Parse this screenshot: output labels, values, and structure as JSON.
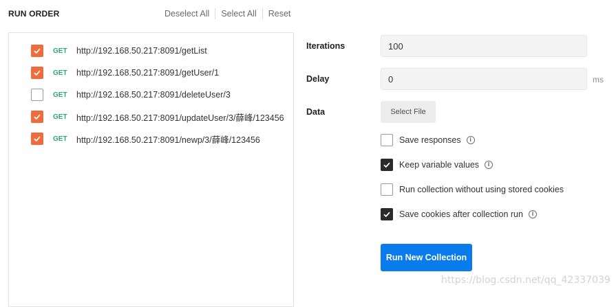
{
  "header": {
    "title": "RUN ORDER",
    "deselect_all": "Deselect All",
    "select_all": "Select All",
    "reset": "Reset"
  },
  "requests": [
    {
      "method": "GET",
      "url": "http://192.168.50.217:8091/getList",
      "checked": true
    },
    {
      "method": "GET",
      "url": "http://192.168.50.217:8091/getUser/1",
      "checked": true
    },
    {
      "method": "GET",
      "url": "http://192.168.50.217:8091/deleteUser/3",
      "checked": false
    },
    {
      "method": "GET",
      "url": "http://192.168.50.217:8091/updateUser/3/薛峰/123456",
      "checked": true
    },
    {
      "method": "GET",
      "url": "http://192.168.50.217:8091/newp/3/薛峰/123456",
      "checked": true
    }
  ],
  "settings": {
    "iterations_label": "Iterations",
    "iterations_value": "100",
    "delay_label": "Delay",
    "delay_value": "0",
    "delay_unit": "ms",
    "data_label": "Data",
    "select_file": "Select File"
  },
  "options": [
    {
      "label": "Save responses",
      "checked": false,
      "info": true
    },
    {
      "label": "Keep variable values",
      "checked": true,
      "info": true
    },
    {
      "label": "Run collection without using stored cookies",
      "checked": false,
      "info": false
    },
    {
      "label": "Save cookies after collection run",
      "checked": true,
      "info": true
    }
  ],
  "run_button": "Run New Collection",
  "watermark": "https://blog.csdn.net/qq_42337039",
  "colors": {
    "accent_orange": "#f26b3a",
    "method_get": "#2ea86e",
    "primary_blue": "#097bed"
  }
}
